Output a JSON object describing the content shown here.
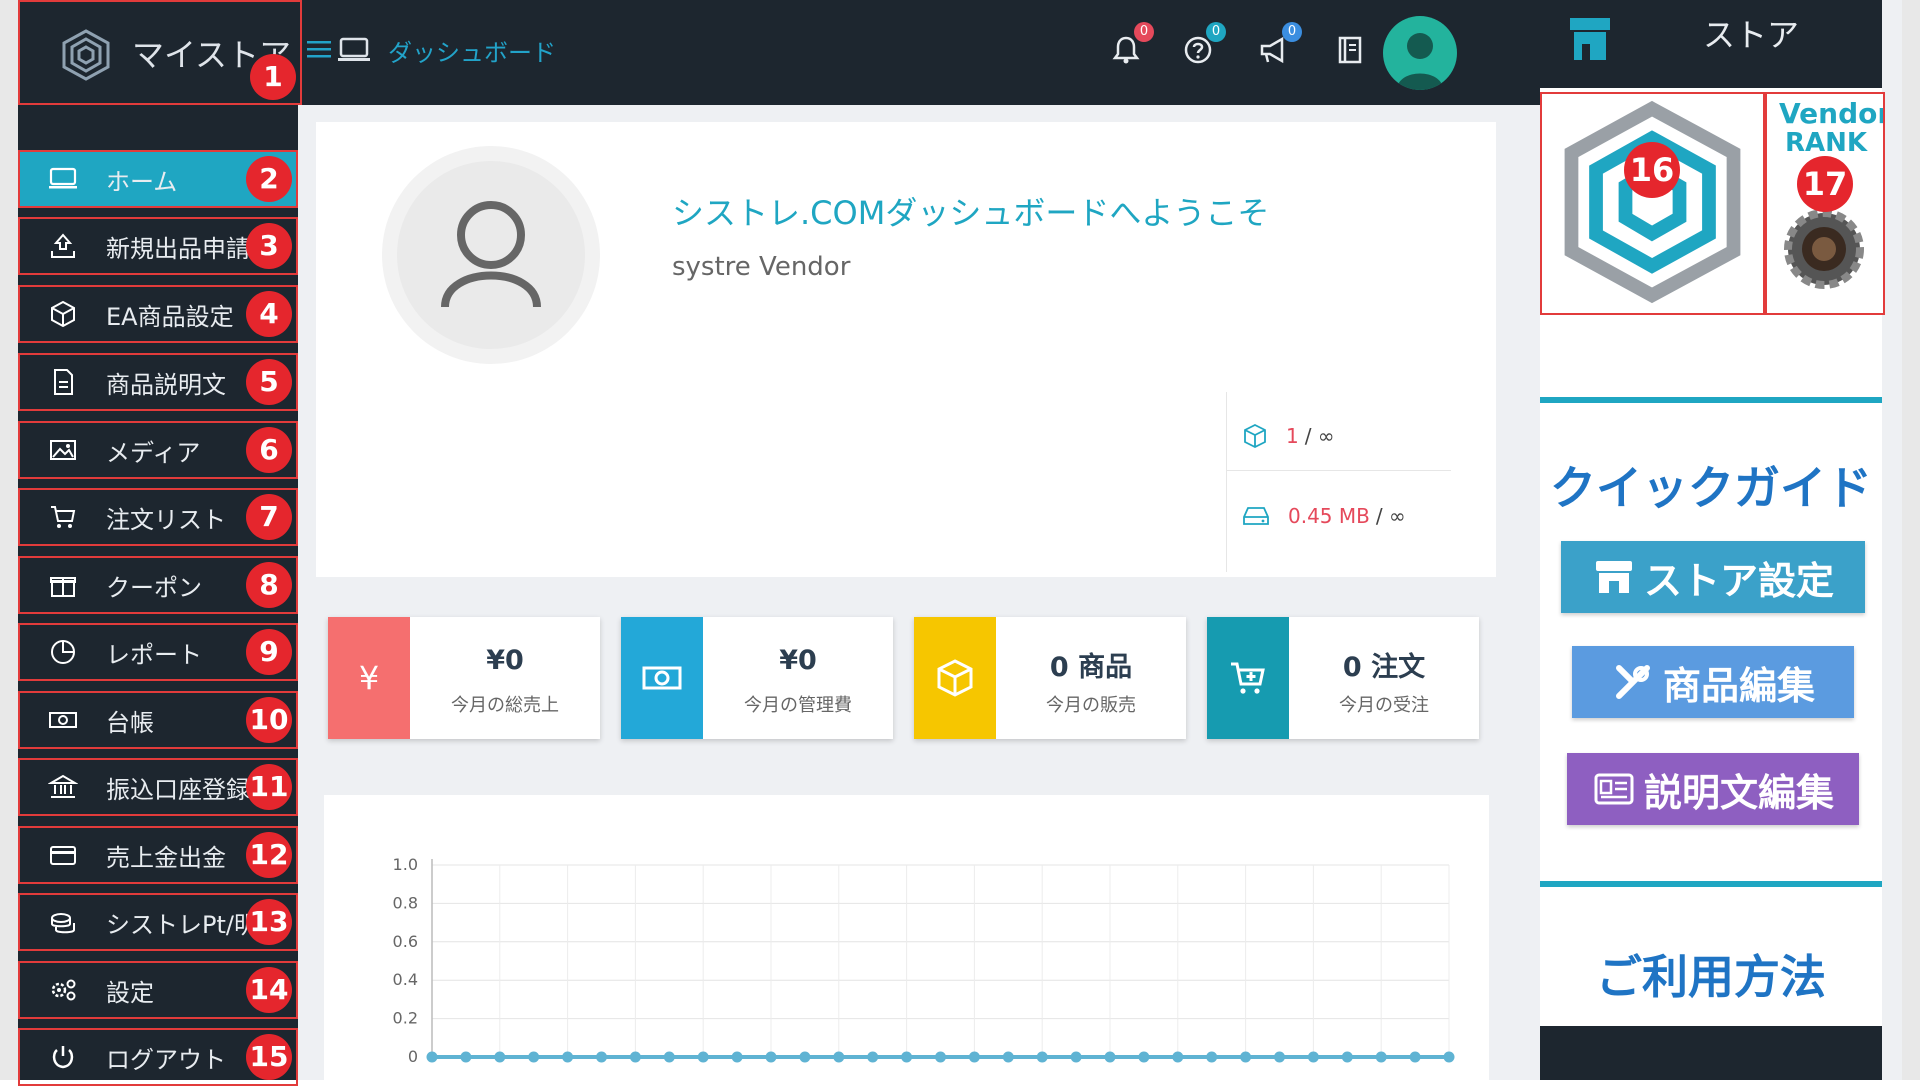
{
  "header": {
    "app_name": "マイストア",
    "breadcrumb": "ダッシュボード",
    "notifications": "0",
    "help": "0",
    "announcements": "0"
  },
  "sidebar": {
    "items": [
      {
        "label": "ホーム",
        "marker": "2"
      },
      {
        "label": "新規出品申請",
        "marker": "3"
      },
      {
        "label": "EA商品設定",
        "marker": "4"
      },
      {
        "label": "商品説明文",
        "marker": "5"
      },
      {
        "label": "メディア",
        "marker": "6"
      },
      {
        "label": "注文リスト",
        "marker": "7"
      },
      {
        "label": "クーポン",
        "marker": "8"
      },
      {
        "label": "レポート",
        "marker": "9"
      },
      {
        "label": "台帳",
        "marker": "10"
      },
      {
        "label": "振込口座登録",
        "marker": "11"
      },
      {
        "label": "売上金出金",
        "marker": "12"
      },
      {
        "label": "シストレPt/明細",
        "marker": "13"
      },
      {
        "label": "設定",
        "marker": "14"
      },
      {
        "label": "ログアウト",
        "marker": "15"
      }
    ],
    "logo_marker": "1"
  },
  "welcome": {
    "title": "シストレ.COMダッシュボードへようこそ",
    "subtitle": "systre Vendor",
    "products_used": "1",
    "products_limit": "/ ∞",
    "storage_used": "0.45 MB",
    "storage_limit": "/ ∞"
  },
  "stats": [
    {
      "value": "¥0",
      "label": "今月の総売上",
      "color": "#f56f6f"
    },
    {
      "value": "¥0",
      "label": "今月の管理費",
      "color": "#23a8d8"
    },
    {
      "value": "0 商品",
      "label": "今月の販売",
      "color": "#f6c600"
    },
    {
      "value": "0 注文",
      "label": "今月の受注",
      "color": "#169bb0"
    }
  ],
  "chart_data": {
    "type": "line",
    "y_ticks": [
      "1.0",
      "0.8",
      "0.6",
      "0.4",
      "0.2",
      "0"
    ],
    "ylim": [
      0,
      1.0
    ],
    "grid": true,
    "series": [
      {
        "values": [
          0,
          0,
          0,
          0,
          0,
          0,
          0,
          0,
          0,
          0,
          0,
          0,
          0,
          0,
          0,
          0,
          0,
          0,
          0,
          0,
          0,
          0,
          0,
          0,
          0,
          0,
          0,
          0,
          0,
          0,
          0
        ],
        "color": "#5fb3d3"
      }
    ]
  },
  "right_panel": {
    "header": "ストア",
    "vendor_title": "Vendor",
    "vendor_rank": "RANK",
    "store_marker": "16",
    "vendor_marker": "17",
    "quick_guide": "クイックガイド",
    "store_settings": "ストア設定",
    "product_edit": "商品編集",
    "description_edit": "説明文編集",
    "usage": "ご利用方法",
    "colors": {
      "store_settings": "#3ba1c9",
      "product_edit": "#5b9be0",
      "description_edit": "#8e5fc1"
    }
  }
}
